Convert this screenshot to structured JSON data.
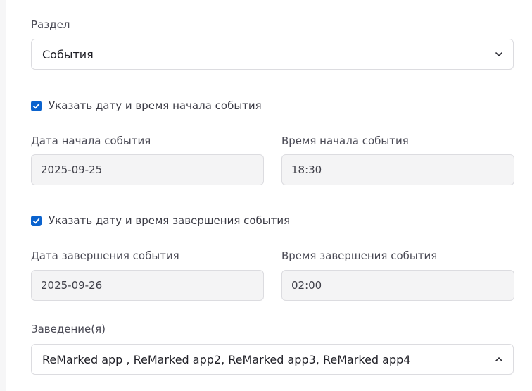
{
  "section": {
    "label": "Раздел",
    "value": "События"
  },
  "start": {
    "checkbox_label": "Указать дату и время начала события",
    "checked": true,
    "date_label": "Дата начала события",
    "date_value": "2025-09-25",
    "time_label": "Время начала события",
    "time_value": "18:30"
  },
  "end": {
    "checkbox_label": "Указать дату и время завершения события",
    "checked": true,
    "date_label": "Дата завершения события",
    "date_value": "2025-09-26",
    "time_label": "Время завершения события",
    "time_value": "02:00"
  },
  "venues": {
    "label": "Заведение(я)",
    "value": "ReMarked app , ReMarked app2, ReMarked app3, ReMarked app4"
  },
  "colors": {
    "accent": "#0b63ce",
    "input_bg": "#f4f4f5",
    "border": "#dcdce0"
  }
}
